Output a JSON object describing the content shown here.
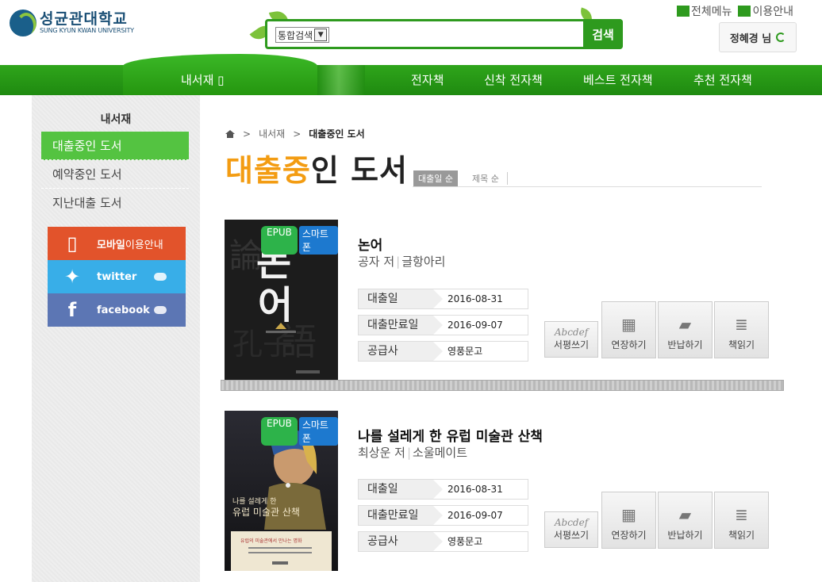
{
  "university": {
    "name_ko": "성균관대학교",
    "name_en": "SUNG KYUN KWAN UNIVERSITY"
  },
  "search": {
    "scope": "통합검색",
    "button": "검색",
    "query": ""
  },
  "top_links": {
    "all_menu": "전체메뉴",
    "guide": "이용안내"
  },
  "user": {
    "name": "정혜경 님"
  },
  "nav": {
    "active": "내서재",
    "items": [
      "전자책",
      "신착 전자책",
      "베스트 전자책",
      "추천 전자책"
    ]
  },
  "sidebar": {
    "title": "내서재",
    "items": [
      {
        "label": "대출중인 도서"
      },
      {
        "label": "예약중인 도서"
      },
      {
        "label": "지난대출 도서"
      }
    ],
    "banners": {
      "mobile": {
        "label_bold": "모바일",
        "label_rest": "이용안내",
        "color": "#e2532b"
      },
      "twitter": {
        "label": "twitter",
        "color": "#38aee8"
      },
      "facebook": {
        "label": "facebook",
        "color": "#5c76b4"
      }
    }
  },
  "breadcrumb": {
    "parent": "내서재",
    "current": "대출중인 도서"
  },
  "page": {
    "title_highlight": "대출중",
    "title_rest": "인 도서",
    "sort_active": "대출일 순",
    "sort_other": "제목 순"
  },
  "labels": {
    "loan_date": "대출일",
    "due_date": "대출만료일",
    "supplier": "공급사",
    "review": "서평쓰기",
    "review_script": "Abcdef",
    "extend": "연장하기",
    "return": "반납하기",
    "read": "책읽기",
    "epub": "EPUB",
    "smartphone": "스마트폰"
  },
  "books": [
    {
      "title": "논어",
      "author": "공자 저",
      "publisher": "글항아리",
      "loan_date": "2016-08-31",
      "due_date": "2016-09-07",
      "supplier": "영풍문고",
      "cover_text": "논어"
    },
    {
      "title": "나를 설레게 한 유럽 미술관 산책",
      "author": "최상운 저",
      "publisher": "소울메이트",
      "loan_date": "2016-08-31",
      "due_date": "2016-09-07",
      "supplier": "영풍문고",
      "cover_text": "나를 설레게 한 유럽 미술관 산책"
    }
  ],
  "colors": {
    "brand_green": "#2e9a1e",
    "title_orange": "#f39c12",
    "sidebar_active": "#54c341"
  }
}
